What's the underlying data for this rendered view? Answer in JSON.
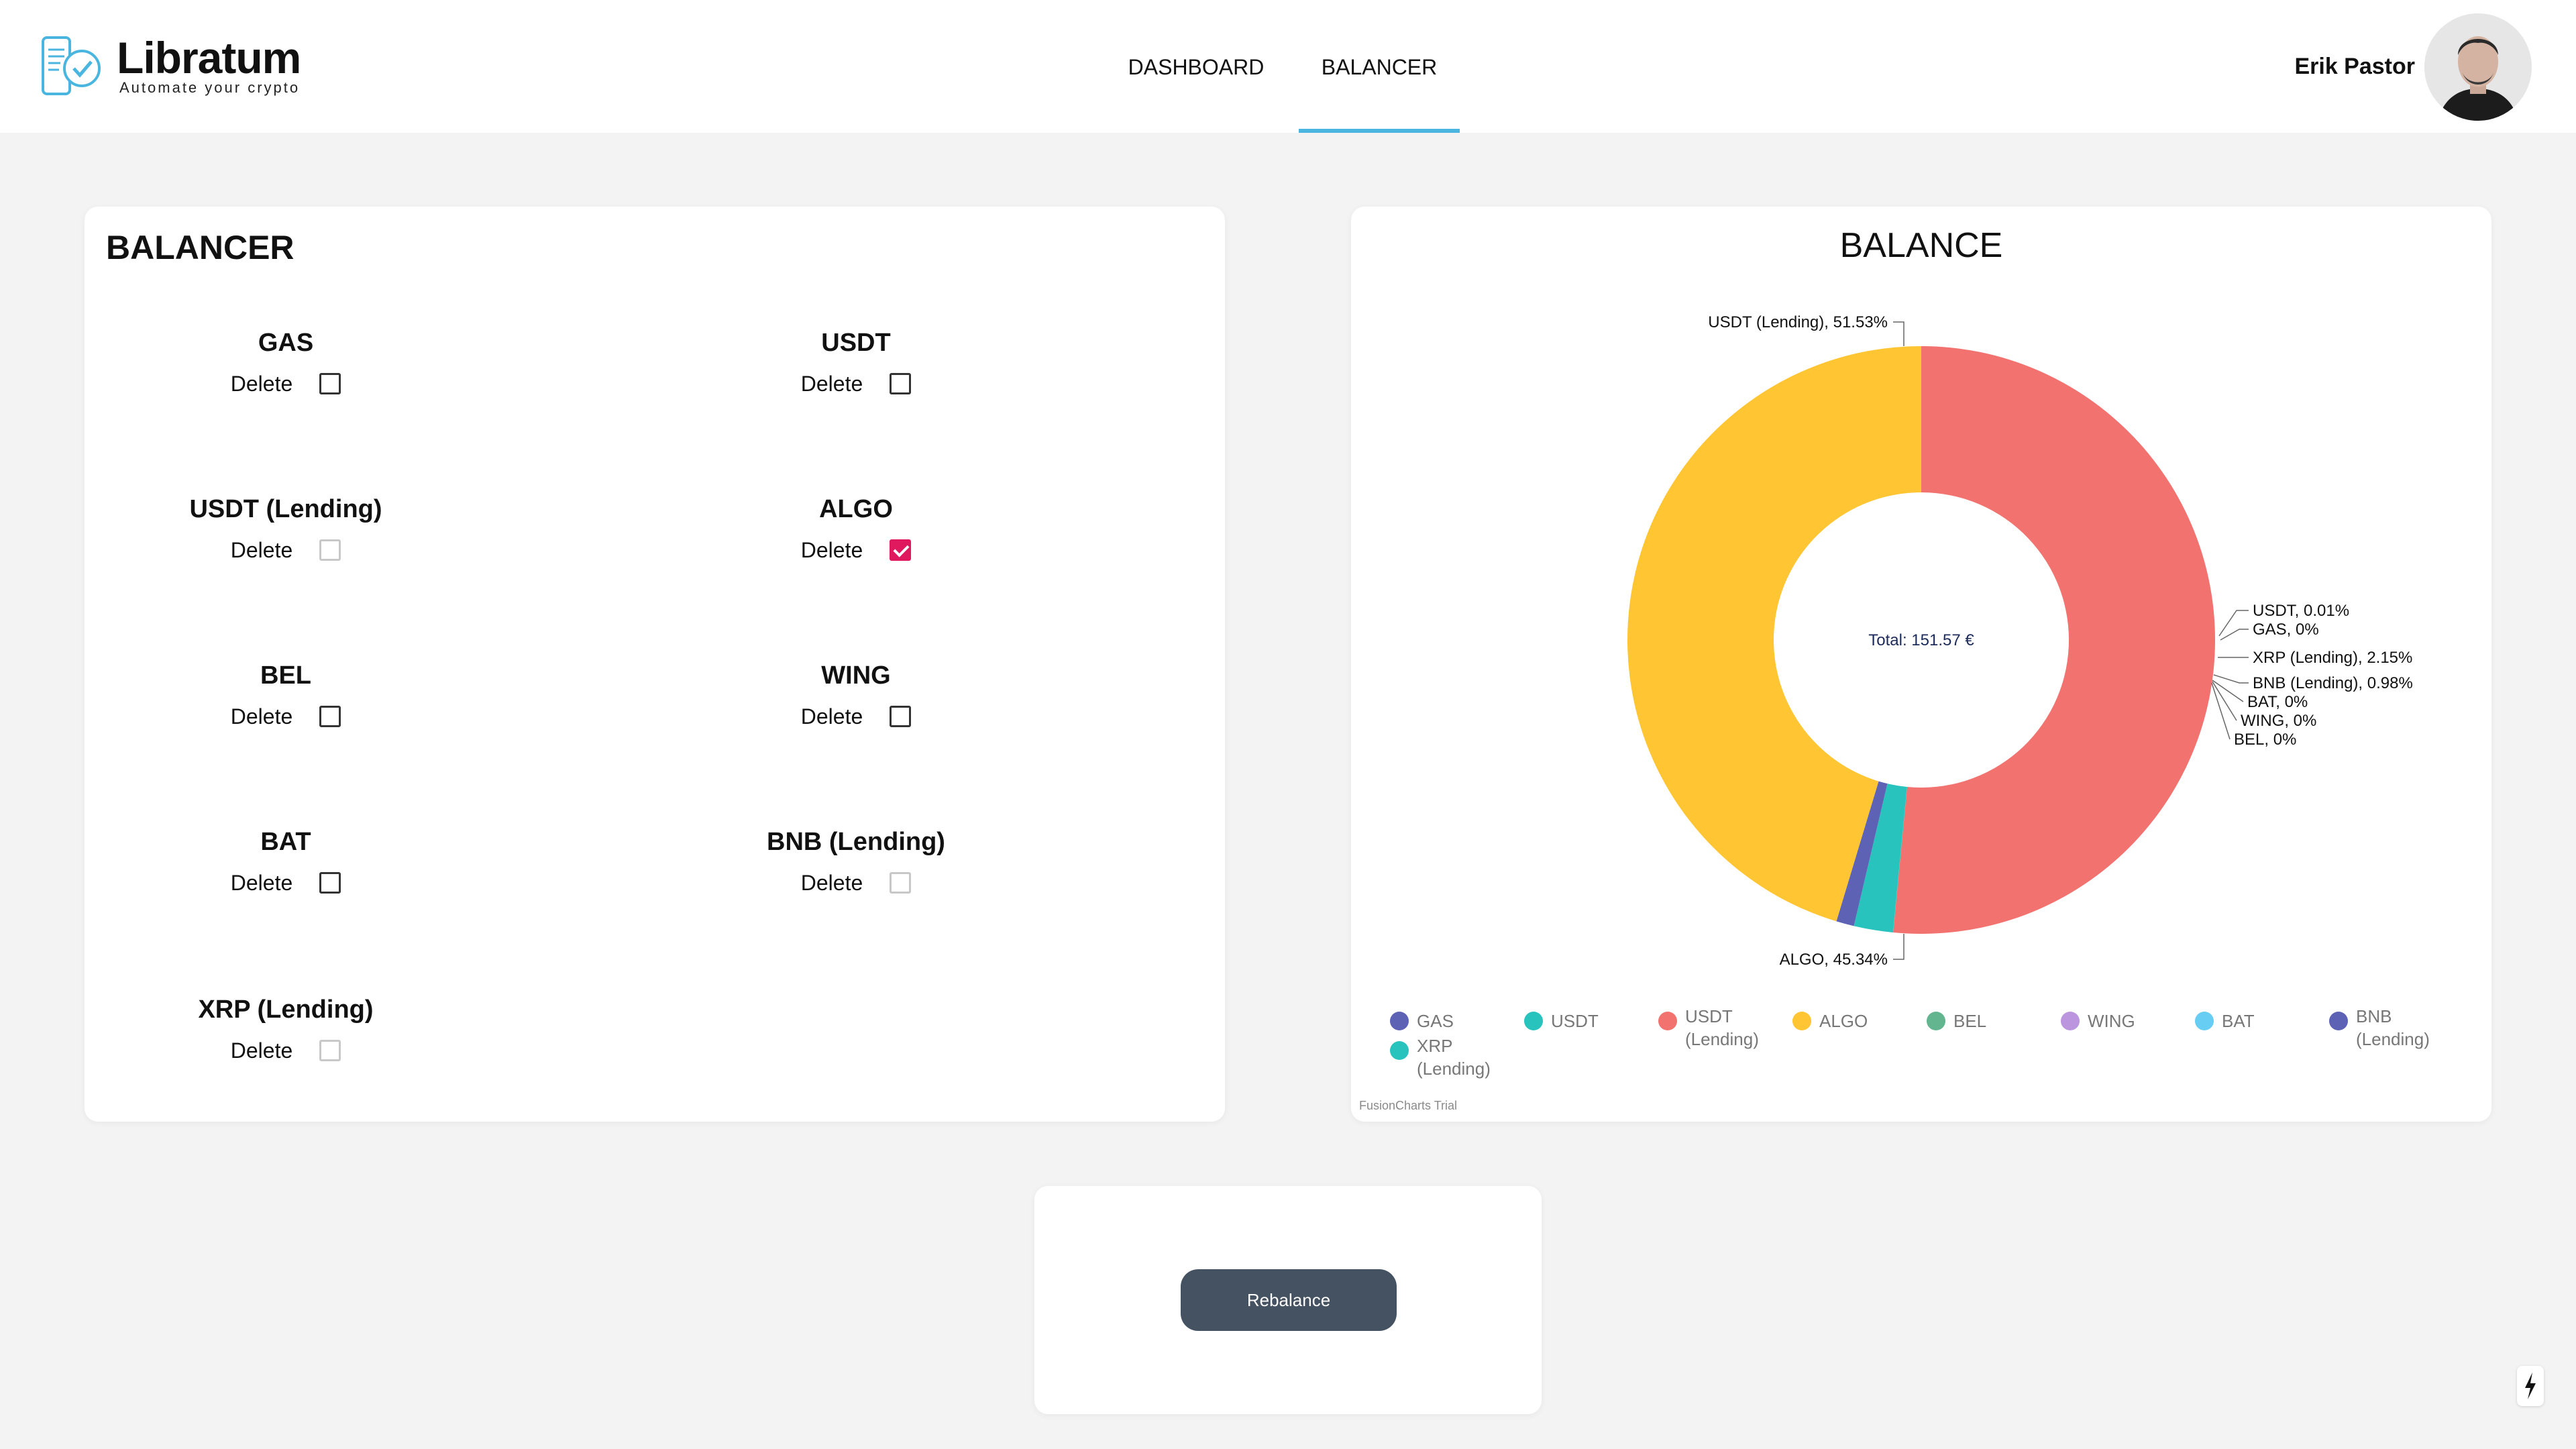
{
  "app": {
    "name": "Libratum",
    "tagline": "Automate your crypto"
  },
  "nav": {
    "items": [
      {
        "label": "DASHBOARD"
      },
      {
        "label": "BALANCER"
      }
    ],
    "active": "BALANCER"
  },
  "user": {
    "name": "Erik Pastor"
  },
  "balancer": {
    "title": "BALANCER",
    "delete_label": "Delete",
    "assets": [
      {
        "name": "GAS",
        "checked": false,
        "disabled": false
      },
      {
        "name": "USDT",
        "checked": false,
        "disabled": false
      },
      {
        "name": "USDT (Lending)",
        "checked": false,
        "disabled": true
      },
      {
        "name": "ALGO",
        "checked": true,
        "disabled": false
      },
      {
        "name": "BEL",
        "checked": false,
        "disabled": false
      },
      {
        "name": "WING",
        "checked": false,
        "disabled": false
      },
      {
        "name": "BAT",
        "checked": false,
        "disabled": false
      },
      {
        "name": "BNB (Lending)",
        "checked": false,
        "disabled": true
      },
      {
        "name": "XRP (Lending)",
        "checked": false,
        "disabled": true
      }
    ]
  },
  "chart_data": {
    "type": "pie",
    "title": "BALANCE",
    "center_label": "Total: 151.57 €",
    "categories": [
      "GAS",
      "USDT",
      "USDT (Lending)",
      "ALGO",
      "BEL",
      "WING",
      "BAT",
      "BNB (Lending)",
      "XRP (Lending)"
    ],
    "values": [
      0,
      0.01,
      51.53,
      45.34,
      0,
      0,
      0,
      0.98,
      2.15
    ],
    "colors": [
      "#5d62b5",
      "#29c3be",
      "#f2726f",
      "#ffc533",
      "#62b58f",
      "#bc95df",
      "#67cdf2",
      "#5d62b5",
      "#29c3be"
    ],
    "data_labels": [
      "USDT (Lending), 51.53%",
      "ALGO, 45.34%",
      "USDT, 0.01%",
      "GAS, 0%",
      "XRP (Lending), 2.15%",
      "BNB (Lending), 0.98%",
      "BAT, 0%",
      "WING, 0%",
      "BEL, 0%"
    ],
    "legend_position": "bottom",
    "watermark": "FusionCharts Trial"
  },
  "rebalance": {
    "button_label": "Rebalance"
  }
}
